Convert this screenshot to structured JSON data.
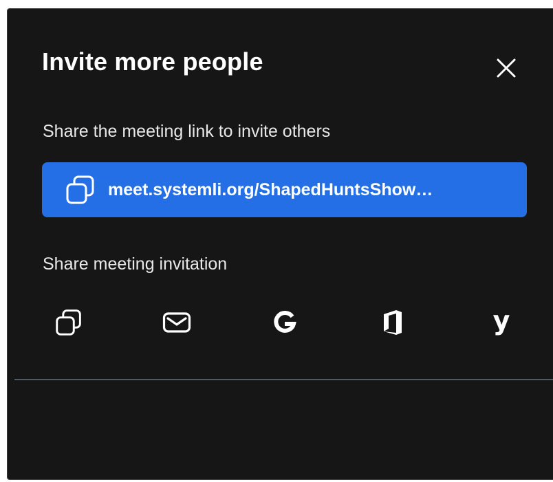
{
  "dialog": {
    "title": "Invite more people",
    "close_icon": "close-icon",
    "link_section": {
      "label": "Share the meeting link to invite others",
      "link_text": "meet.systemli.org/ShapedHuntsShow…",
      "icon": "copy-icon"
    },
    "invite_section": {
      "label": "Share meeting invitation",
      "options": [
        {
          "name": "copy-invitation",
          "icon": "copy-icon"
        },
        {
          "name": "email",
          "icon": "mail-icon"
        },
        {
          "name": "google-calendar",
          "icon": "google-icon"
        },
        {
          "name": "outlook-office",
          "icon": "office-icon"
        },
        {
          "name": "yahoo",
          "icon": "yahoo-icon"
        }
      ],
      "yahoo_glyph": "y"
    }
  },
  "colors": {
    "background": "#161616",
    "accent": "#246fe5",
    "text": "#ffffff",
    "divider": "#545a63"
  }
}
